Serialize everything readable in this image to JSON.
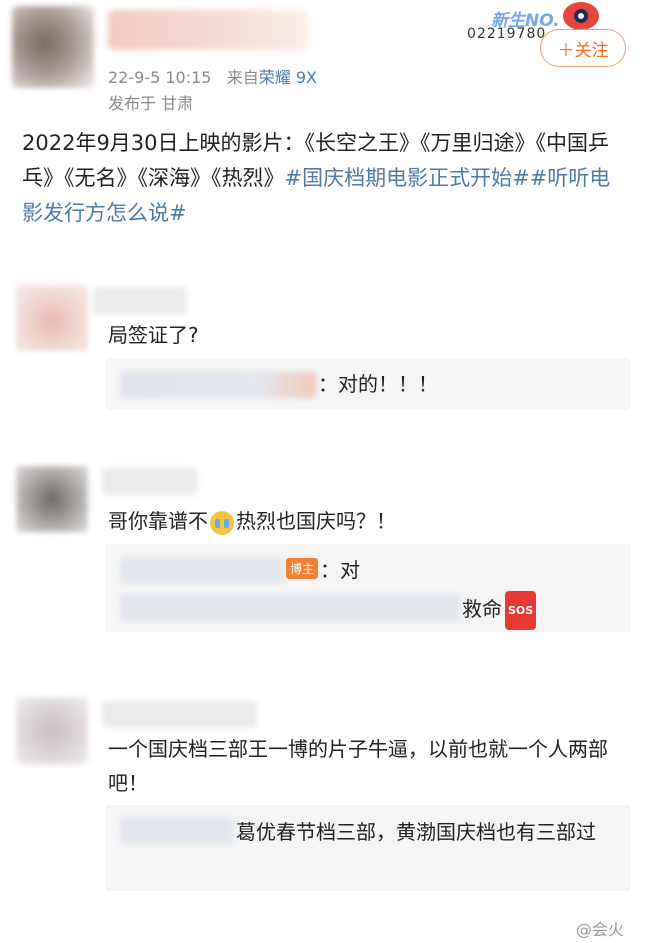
{
  "post": {
    "timestamp": "22-9-5 10:15",
    "source_prefix": "来自",
    "device": "荣耀 9X",
    "location": "发布于 甘肃",
    "badge_label": "新生NO.",
    "badge_number": "02219780",
    "follow_label": "＋关注",
    "text_plain": "2022年9月30日上映的影片：《长空之王》《万里归途》《中国乒乓》《无名》《深海》《热烈》",
    "topic_1": "#国庆档期电影正式开始#",
    "topic_2": "#听听电影发行方怎么说#"
  },
  "comments": [
    {
      "text": "局签证了?",
      "replies": [
        {
          "text": "：对的！！！"
        }
      ]
    },
    {
      "text_before_emoji": "哥你靠谱不",
      "text_after_emoji": "热烈也国庆吗？！",
      "replies": [
        {
          "owner_tag": "博主",
          "text": "：对"
        },
        {
          "text": "救命",
          "sos_label": "SOS"
        }
      ]
    },
    {
      "text": "一个国庆档三部王一博的片子牛逼，以前也就一个人两部吧！",
      "replies": [
        {
          "text": "葛优春节档三部，黄渤国庆档也有三部过"
        }
      ]
    }
  ],
  "watermark": "@会火",
  "colors": {
    "topic": "#4f7aa8",
    "follow": "#f36c24",
    "reply_bg": "#f5f5f5",
    "owner_tag": "#f37e36"
  },
  "icons": [
    "crying-face-emoji-icon",
    "sos-emoji-icon",
    "weibo-eye-icon"
  ]
}
